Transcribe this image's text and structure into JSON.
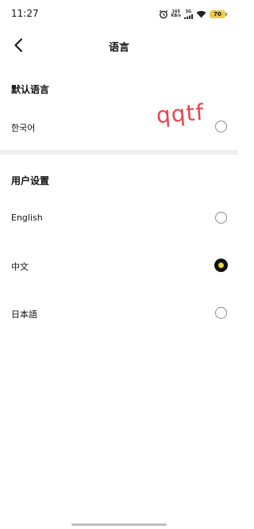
{
  "status_bar": {
    "time": "11:27",
    "net_speed_value": "165",
    "net_speed_unit": "KB/s",
    "network_tag": "5G",
    "battery": "70",
    "icons": [
      "alarm-icon",
      "signal-icon",
      "wifi-icon",
      "battery-icon"
    ]
  },
  "nav": {
    "back_icon": "chevron-left-icon",
    "title": "语言"
  },
  "default_section": {
    "header": "默认语言",
    "option": {
      "label": "한국어",
      "selected": false
    },
    "annotation": "qqtf"
  },
  "user_section": {
    "header": "用户设置",
    "options": [
      {
        "label": "English",
        "selected": false
      },
      {
        "label": "中文",
        "selected": true
      },
      {
        "label": "日本語",
        "selected": false
      }
    ]
  },
  "colors": {
    "accent": "#f2d33a",
    "selected_radio": "#111111",
    "annotation": "#e8454d",
    "divider": "#efefef",
    "battery": "#f1c945"
  }
}
